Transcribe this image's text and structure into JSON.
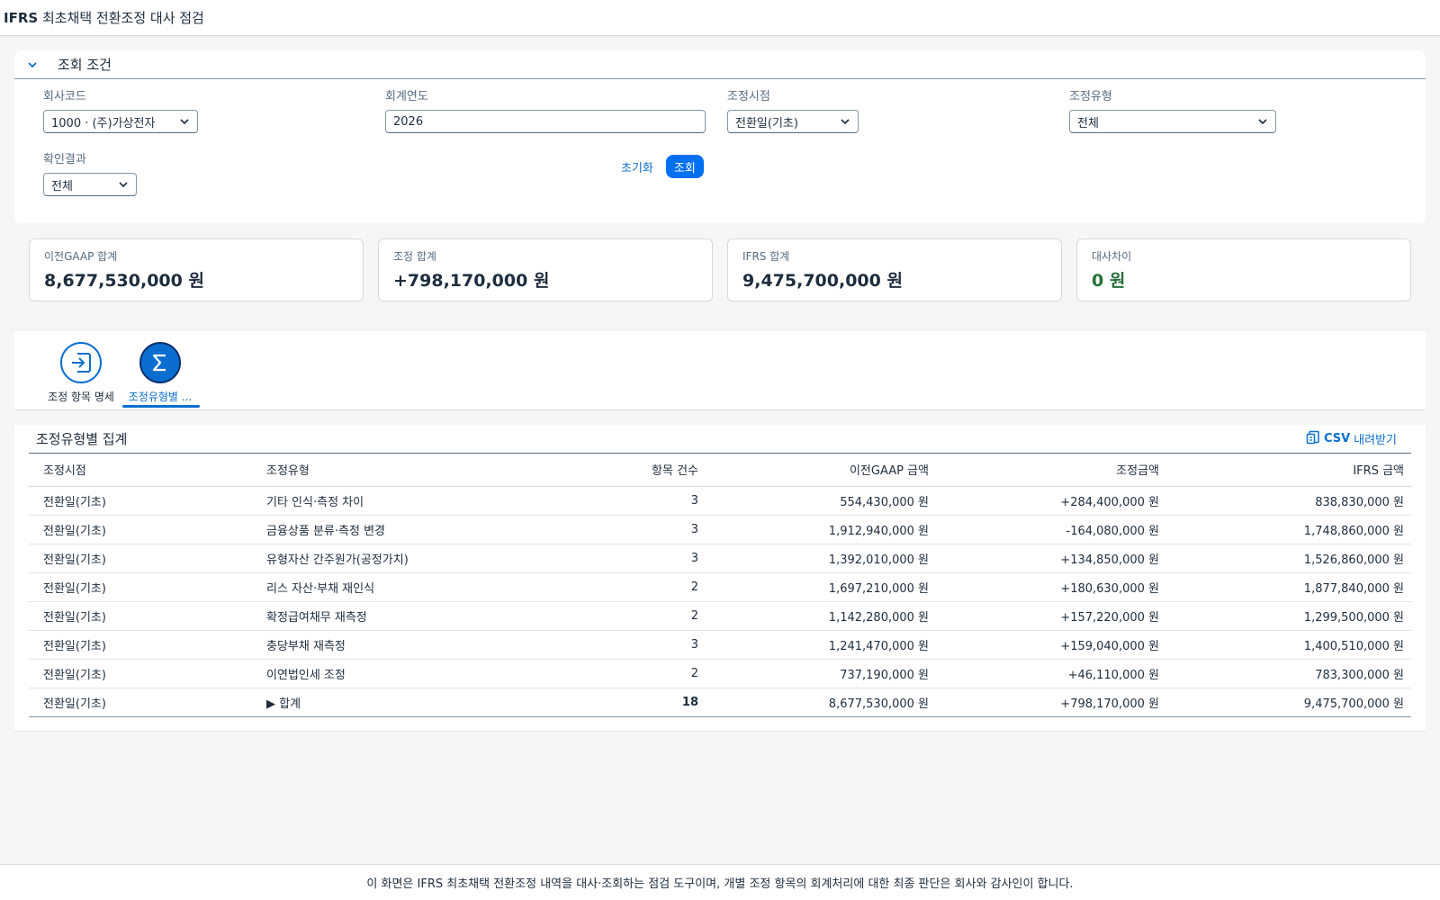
{
  "app": {
    "title_prefix": "IFRS",
    "title_rest": " 최초채택 전환조정 대사 점검"
  },
  "filterbar": {
    "title": "조회 조건",
    "company": {
      "label": "회사코드",
      "value": "1000 · (주)가상전자"
    },
    "year": {
      "label": "회계연도",
      "value": "2026"
    },
    "timing": {
      "label": "조정시점",
      "value": "전환일(기초)"
    },
    "adj_type": {
      "label": "조정유형",
      "value": "전체"
    },
    "check_result": {
      "label": "확인결과",
      "value": "전체"
    },
    "reset_label": "초기화",
    "search_label": "조회"
  },
  "kpis": [
    {
      "label": "이전GAAP 합계",
      "value": "8,677,530,000 원"
    },
    {
      "label": "조정 합계",
      "value": "+798,170,000 원"
    },
    {
      "label": "IFRS 합계",
      "value": "9,475,700,000 원"
    },
    {
      "label": "대사차이",
      "value": "0 원",
      "status_color": "#256f3a"
    }
  ],
  "tabs": [
    {
      "label": "조정 항목 명세",
      "icon": "enter-icon"
    },
    {
      "label": "조정유형별 ...",
      "icon": "sigma-icon",
      "active": true
    }
  ],
  "summary": {
    "title": "조정유형별 집계",
    "csv_label": "CSV 내려받기",
    "columns": [
      "조정시점",
      "조정유형",
      "항목 건수",
      "이전GAAP 금액",
      "조정금액",
      "IFRS 금액"
    ],
    "rows": [
      [
        "전환일(기초)",
        "기타 인식·측정 차이",
        "3",
        "554,430,000 원",
        "+284,400,000 원",
        "838,830,000 원"
      ],
      [
        "전환일(기초)",
        "금융상품 분류·측정 변경",
        "3",
        "1,912,940,000 원",
        "-164,080,000 원",
        "1,748,860,000 원"
      ],
      [
        "전환일(기초)",
        "유형자산 간주원가(공정가치)",
        "3",
        "1,392,010,000 원",
        "+134,850,000 원",
        "1,526,860,000 원"
      ],
      [
        "전환일(기초)",
        "리스 자산·부채 재인식",
        "2",
        "1,697,210,000 원",
        "+180,630,000 원",
        "1,877,840,000 원"
      ],
      [
        "전환일(기초)",
        "확정급여채무 재측정",
        "2",
        "1,142,280,000 원",
        "+157,220,000 원",
        "1,299,500,000 원"
      ],
      [
        "전환일(기초)",
        "충당부채 재측정",
        "3",
        "1,241,470,000 원",
        "+159,040,000 원",
        "1,400,510,000 원"
      ],
      [
        "전환일(기초)",
        "이연법인세 조정",
        "2",
        "737,190,000 원",
        "+46,110,000 원",
        "783,300,000 원"
      ]
    ],
    "total": [
      "전환일(기초)",
      "▶ 합계",
      "18",
      "8,677,530,000 원",
      "+798,170,000 원",
      "9,475,700,000 원"
    ]
  },
  "footer": {
    "text": "이 화면은 IFRS 최초채택 전환조정 내역을 대사·조회하는 점검 도구이며, 개별 조정 항목의 회계처리에 대한 최종 판단은 회사와 감사인이 합니다."
  }
}
